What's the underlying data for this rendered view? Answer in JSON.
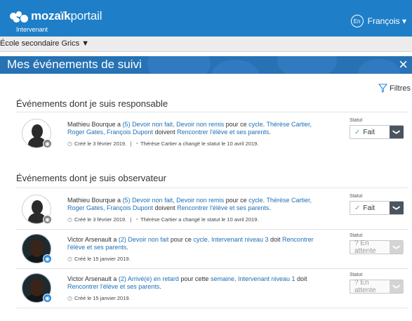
{
  "header": {
    "logo_bold": "mozaïk",
    "logo_thin": "portail",
    "logo_sub": "Intervenant",
    "lang_badge": "En",
    "user_label": "François ▾"
  },
  "school": {
    "label": "École secondaire Grics ▼"
  },
  "page": {
    "title": "Mes événements de suivi",
    "close": "×",
    "filters": "Filtres"
  },
  "sections": {
    "responsible": "Événements dont je suis responsable",
    "observer": "Événements dont je suis observateur"
  },
  "events": [
    {
      "m1": "Mathieu Bourque a ",
      "m2": "(5) Devoir non fait, Devoir non remis",
      "m3": " pour ce ",
      "m4": "cycle",
      "m5": ". ",
      "m6": "Thérèse Cartier, Roger Gates, François Dupont",
      "m7": " doivent ",
      "m8": "Rencontrer l'élève et ses parents",
      "m9": ".",
      "created": "Créé le 3 février 2019.",
      "sep": "|",
      "changed": "Thérèse Cartier a changé le statut le 10 avril 2019.",
      "status_label": "Statut",
      "status": "Fait"
    },
    {
      "m1": "Mathieu Bourque a ",
      "m2": "(5) Devoir non fait, Devoir non remis",
      "m3": " pour ce ",
      "m4": "cycle",
      "m5": ". ",
      "m6": "Thérèse Cartier, Roger Gates, François Dupont",
      "m7": " doivent ",
      "m8": "Rencontrer l'élève et ses parents",
      "m9": ".",
      "created": "Créé le 3 février 2019.",
      "sep": "|",
      "changed": "Thérèse Cartier a changé le statut le 10 avril 2019.",
      "status_label": "Statut",
      "status": "Fait"
    },
    {
      "m1": "Victor Arsenault a ",
      "m2": "(2) Devoir non fait",
      "m3": " pour ce ",
      "m4": "cycle",
      "m5": ". ",
      "m6": "Intervenant niveau 3",
      "m7": " doit ",
      "m8": "Rencontrer l'élève et ses parents",
      "m9": ".",
      "created": "Créé le 15 janvier 2019.",
      "status_label": "Statut",
      "status": "? En attente"
    },
    {
      "m1": "Victor Arsenault a ",
      "m2": "(2) Arrivé(e) en retard",
      "m3": " pour cette ",
      "m4": "semaine",
      "m5": ". ",
      "m6": "Intervenant niveau 1",
      "m7": " doit ",
      "m8": "Rencontrer l'élève et ses parents",
      "m9": ".",
      "created": "Créé le 15 janvier 2019.",
      "status_label": "Statut",
      "status": "? En attente"
    }
  ],
  "colors": {
    "header_blue": "#1e7fc8",
    "title_blue": "#2672b4",
    "link_blue": "#1f6fb5",
    "check_green": "#5cb85c"
  }
}
